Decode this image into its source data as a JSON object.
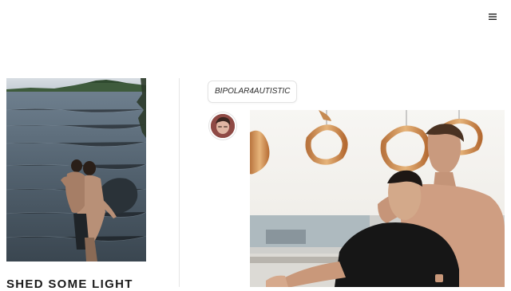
{
  "header": {
    "menu_icon": "hamburger-menu-icon"
  },
  "left_column": {
    "title": "SHED SOME LIGHT",
    "photo_desc": ""
  },
  "post": {
    "blog_name": "BIPOLAR4AUTISTIC",
    "avatar_icon": "avatar-image"
  },
  "colors": {
    "page_background": "#ffffff",
    "divider": "#e6e6e6",
    "title_text": "#1b1b1b",
    "tag_border": "#e3e3e3"
  }
}
